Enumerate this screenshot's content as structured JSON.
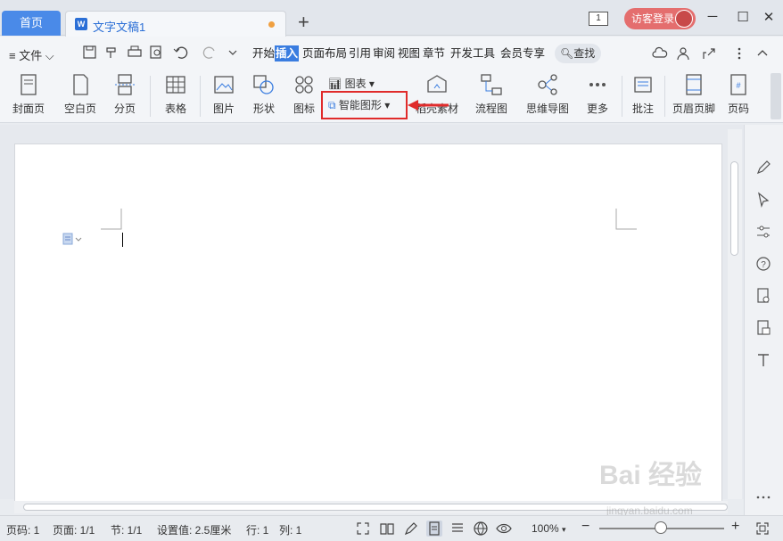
{
  "titlebar": {
    "home_tab": "首页",
    "doc_tab": "文字文稿1",
    "doc_icon": "W",
    "add_tab": "+",
    "window_count": "1",
    "login": "访客登录",
    "minimize": "─",
    "maximize": "☐",
    "close": "✕"
  },
  "menubar": {
    "file": "≡ 文件 ⌵",
    "tabs": [
      "开始",
      "插入",
      "页面布局",
      "引用",
      "审阅",
      "视图",
      "章节",
      "开发工具",
      "会员专享"
    ],
    "active_tab": "插入",
    "search": "查找"
  },
  "ribbon": {
    "buttons": [
      {
        "label": "封面页",
        "icon": "cover-page-icon"
      },
      {
        "label": "空白页",
        "icon": "blank-page-icon"
      },
      {
        "label": "分页",
        "icon": "page-break-icon"
      },
      {
        "label": "表格",
        "icon": "table-icon"
      },
      {
        "label": "图片",
        "icon": "picture-icon"
      },
      {
        "label": "形状",
        "icon": "shape-icon"
      },
      {
        "label": "图标",
        "icon": "icons-icon"
      },
      {
        "label": "稻壳素材",
        "icon": "material-icon"
      },
      {
        "label": "流程图",
        "icon": "flowchart-icon"
      },
      {
        "label": "思维导图",
        "icon": "mindmap-icon"
      },
      {
        "label": "更多",
        "icon": "more-icon"
      },
      {
        "label": "批注",
        "icon": "comment-icon"
      },
      {
        "label": "页眉页脚",
        "icon": "header-footer-icon"
      },
      {
        "label": "页码",
        "icon": "page-number-icon"
      }
    ],
    "chart": "图表",
    "smart_graphic": "智能图形"
  },
  "statusbar": {
    "page_num": "页码: 1",
    "pages": "页面: 1/1",
    "section": "节: 1/1",
    "setting": "设置值: 2.5厘米",
    "row": "行: 1",
    "col": "列: 1",
    "zoom": "100%",
    "zoom_level": 1.0
  },
  "watermark": {
    "logo": "Bai 经验",
    "url": "jingyan.baidu.com"
  }
}
